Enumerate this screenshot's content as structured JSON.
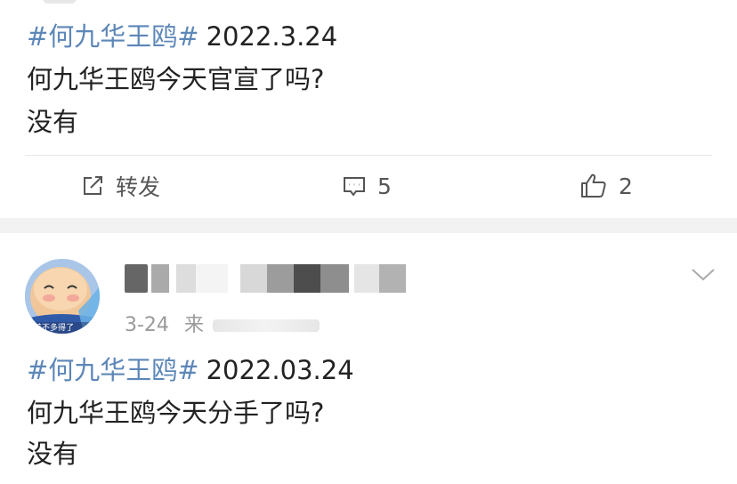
{
  "posts": [
    {
      "hashtag": "#何九华王鸥#",
      "date": "2022.3.24",
      "lines": [
        "何九华王鸥今天官宣了吗?",
        "没有"
      ],
      "actions": {
        "repost_label": "转发",
        "comment_count": "5",
        "like_count": "2"
      }
    },
    {
      "meta_time": "3-24",
      "meta_source_partial": "来",
      "avatar_caption": "差不多得了",
      "hashtag": "#何九华王鸥#",
      "date": "2022.03.24",
      "lines": [
        "何九华王鸥今天分手了吗?",
        "没有"
      ]
    }
  ],
  "colors": {
    "hashtag": "#5d87b8",
    "text": "#222222",
    "meta": "#9a9a9a",
    "separator": "#f2f2f2"
  },
  "icons": [
    "repost-icon",
    "comment-icon",
    "like-icon",
    "chevron-down-icon"
  ]
}
